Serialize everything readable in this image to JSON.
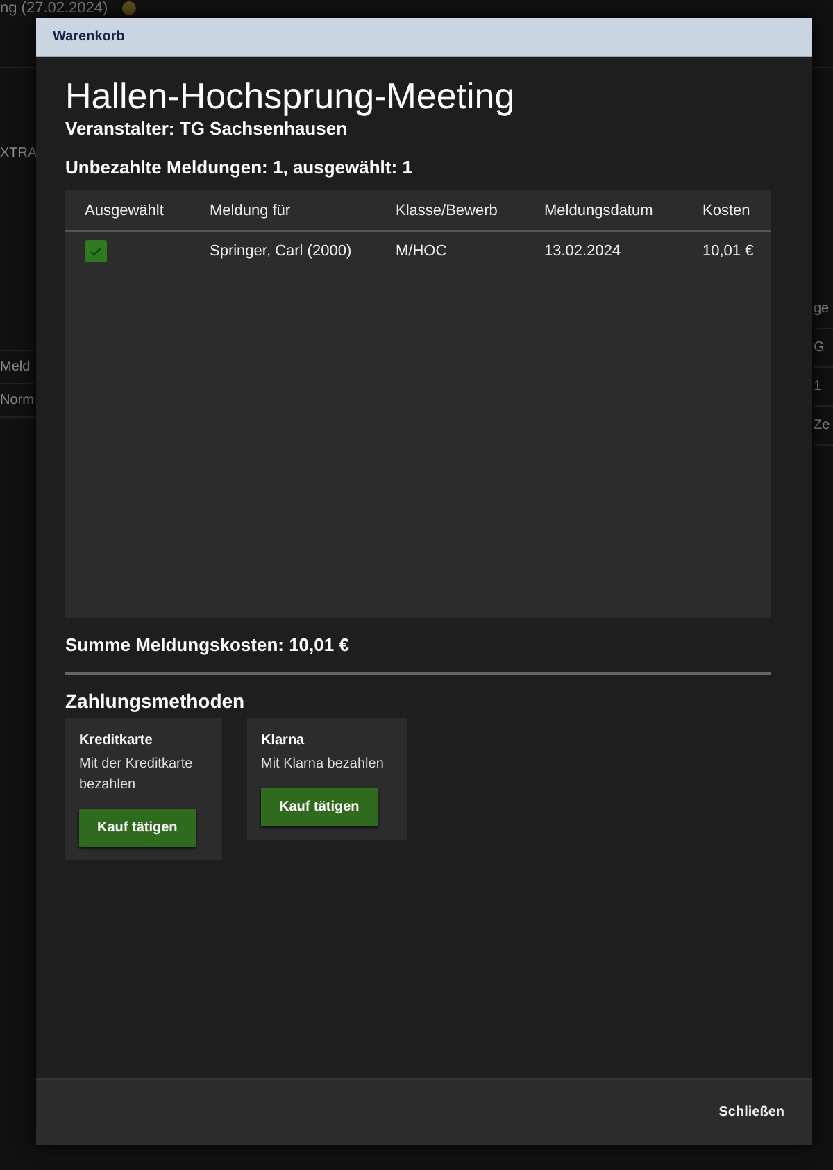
{
  "background": {
    "title": "ng (27.02.2024)",
    "left_fragments": [
      "XTRA",
      "Meld",
      "Norm"
    ],
    "right_fragments": [
      "ge",
      "G",
      "1",
      "Ze"
    ]
  },
  "dialog": {
    "title": "Warenkorb",
    "heading": "Hallen-Hochsprung-Meeting",
    "organizer": "Veranstalter: TG Sachsenhausen",
    "summary": "Unbezahlte Meldungen: 1, ausgewählt: 1",
    "table": {
      "columns": [
        "Ausgewählt",
        "Meldung für",
        "Klasse/Bewerb",
        "Meldungsdatum",
        "Kosten"
      ],
      "rows": [
        {
          "checked": true,
          "cells": [
            "",
            "Springer, Carl (2000)",
            "M/HOC",
            "13.02.2024",
            "10,01 €"
          ]
        }
      ]
    },
    "total": "Summe Meldungskosten: 10,01 €",
    "payment_heading": "Zahlungsmethoden",
    "payment_methods": [
      {
        "title": "Kreditkarte",
        "description": "Mit der Kreditkarte bezahlen",
        "button": "Kauf tätigen"
      },
      {
        "title": "Klarna",
        "description": "Mit Klarna bezahlen",
        "button": "Kauf tätigen"
      }
    ],
    "close_button": "Schließen"
  }
}
